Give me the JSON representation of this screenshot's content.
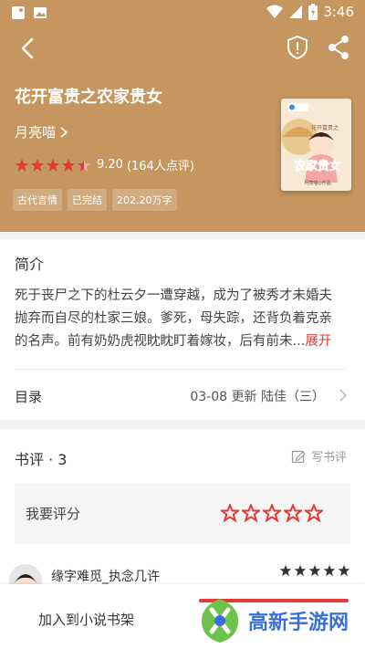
{
  "statusbar": {
    "time": "3:46"
  },
  "book": {
    "title": "花开富贵之农家贵女",
    "author": "月亮喵",
    "score": "9.20",
    "rating_count": "(164人点评)",
    "rating_stars": 4.5,
    "tags": [
      "古代言情",
      "已完结",
      "202.20万字"
    ],
    "cover": {
      "small_title": "花开富贵之",
      "big_title": "农家贵女",
      "author_line": "月亮喵◎作品"
    }
  },
  "intro": {
    "title": "简介",
    "text": "死于丧尸之下的杜云夕一遭穿越，成为了被秀才未婚夫抛弃而自尽的杜家三娘。爹死，母失踪，还背负着克亲的名声。前有奶奶虎视眈眈盯着嫁妆，后有前未...",
    "expand": "展开"
  },
  "toc": {
    "label": "目录",
    "info": "03-08  更新  陆佳（三）"
  },
  "reviews": {
    "title": "书评 · 3",
    "write": "写书评",
    "rate_label": "我要评分",
    "items": [
      {
        "name": "缘字难觅_执念几许",
        "stars": 5
      }
    ]
  },
  "bottom": {
    "add_shelf": "加入到小说书架"
  },
  "watermark": {
    "text": "高新手游网"
  },
  "colors": {
    "header_bg": "#c5965f",
    "accent_red": "#e53935",
    "watermark_blue": "#3a6fd8"
  }
}
